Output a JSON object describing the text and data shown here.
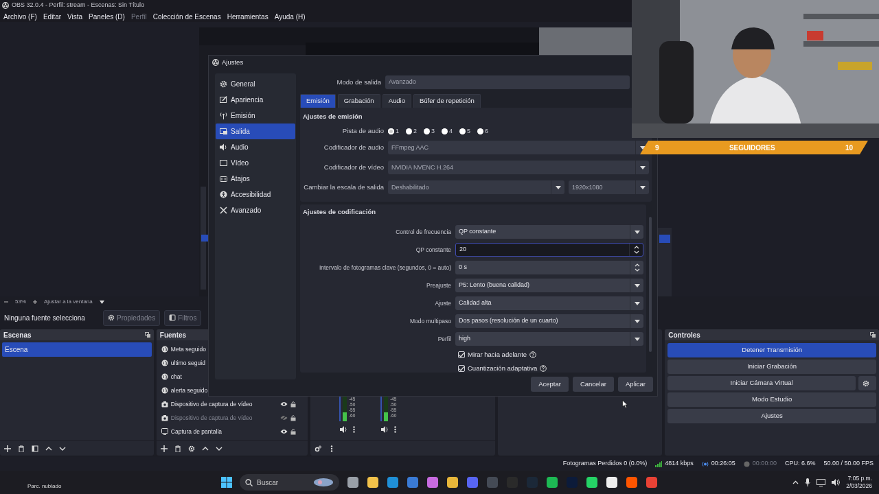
{
  "window": {
    "title": "OBS 32.0.4 - Perfil: stream - Escenas: Sin Título"
  },
  "menu": [
    {
      "label": "Archivo (F)",
      "disabled": false
    },
    {
      "label": "Editar",
      "disabled": false
    },
    {
      "label": "Vista",
      "disabled": false
    },
    {
      "label": "Paneles (D)",
      "disabled": false
    },
    {
      "label": "Perfil",
      "disabled": true
    },
    {
      "label": "Colección de Escenas",
      "disabled": false
    },
    {
      "label": "Herramientas",
      "disabled": false
    },
    {
      "label": "Ayuda (H)",
      "disabled": false
    }
  ],
  "zoom_bar": {
    "zoom": "53%",
    "fit": "Ajustar a la ventana"
  },
  "source_bar": {
    "status": "Ninguna fuente selecciona",
    "buttons": [
      {
        "label": "Propiedades",
        "disabled": true
      },
      {
        "label": "Filtros",
        "disabled": true
      }
    ]
  },
  "scenes": {
    "title": "Escenas",
    "items": [
      {
        "label": "Escena",
        "selected": true
      }
    ]
  },
  "sources": {
    "title": "Fuentes",
    "items": [
      {
        "label": "Meta seguido",
        "kind": "browser"
      },
      {
        "label": "ultimo seguid",
        "kind": "browser"
      },
      {
        "label": "chat",
        "kind": "browser"
      },
      {
        "label": "alerta seguido",
        "kind": "browser"
      },
      {
        "label": "Dispositivo de captura de vídeo",
        "kind": "camera",
        "visible": true
      },
      {
        "label": "Dispositivo de captura de vídeo",
        "kind": "camera",
        "visible": false
      },
      {
        "label": "Captura de pantalla",
        "kind": "screen",
        "visible": true
      }
    ]
  },
  "mixer": {
    "channels": [
      {
        "slider": {
          "level": 1
        },
        "meter": {
          "level": 0.35
        },
        "scale": [
          "-45",
          "-50",
          "-55",
          "-60"
        ]
      },
      {
        "slider": {
          "level": 1
        },
        "meter": {
          "level": 0.35
        },
        "scale": [
          "-45",
          "-50",
          "-55",
          "-60"
        ]
      }
    ]
  },
  "controls": {
    "title": "Controles",
    "buttons": [
      {
        "label": "Detener Transmisión",
        "active": true
      },
      {
        "label": "Iniciar Grabación",
        "active": false
      },
      {
        "label": "Iniciar Cámara Virtual",
        "active": false
      },
      {
        "label": "Modo Estudio",
        "active": false
      },
      {
        "label": "Ajustes",
        "active": false
      }
    ]
  },
  "goal_bar": {
    "current": "9",
    "label": "SEGUIDORES",
    "target": "10"
  },
  "settings": {
    "title": "Ajustes",
    "sidebar": [
      {
        "label": "General",
        "selected": false
      },
      {
        "label": "Apariencia",
        "selected": false
      },
      {
        "label": "Emisión",
        "selected": false
      },
      {
        "label": "Salida",
        "selected": true
      },
      {
        "label": "Audio",
        "selected": false
      },
      {
        "label": "Vídeo",
        "selected": false
      },
      {
        "label": "Atajos",
        "selected": false
      },
      {
        "label": "Accesibilidad",
        "selected": false
      },
      {
        "label": "Avanzado",
        "selected": false
      }
    ],
    "output_mode": {
      "label": "Modo de salida",
      "value": "Avanzado",
      "disabled": true
    },
    "tabs": [
      {
        "label": "Emisión",
        "selected": true
      },
      {
        "label": "Grabación",
        "selected": false
      },
      {
        "label": "Audio",
        "selected": false
      },
      {
        "label": "Búfer de repetición",
        "selected": false
      }
    ],
    "streaming": {
      "title": "Ajustes de emisión",
      "audio_track": {
        "label": "Pista de audio",
        "options": [
          {
            "label": "1",
            "selected": true
          },
          {
            "label": "2",
            "selected": false
          },
          {
            "label": "3",
            "selected": false
          },
          {
            "label": "4",
            "selected": false
          },
          {
            "label": "5",
            "selected": false
          },
          {
            "label": "6",
            "selected": false
          }
        ]
      },
      "fields": [
        {
          "label": "Codificador de audio",
          "value": "FFmpeg AAC",
          "disabled": true
        },
        {
          "label": "Codificador de vídeo",
          "value": "NVIDIA NVENC H.264",
          "disabled": true
        },
        {
          "label": "Cambiar la escala de salida",
          "value": "Deshabilitado",
          "value_2": "1920x1080",
          "disabled": true
        }
      ]
    },
    "encoder": {
      "title": "Ajustes de codificación",
      "fields": [
        {
          "label": "Control de frecuencia",
          "value": "QP constante",
          "kind": "select",
          "focused": false
        },
        {
          "label": "QP constante",
          "value": "20",
          "kind": "spin",
          "focused": true
        },
        {
          "label": "Intervalo de fotogramas clave (segundos, 0 = auto)",
          "value": "0 s",
          "kind": "spin",
          "focused": false
        },
        {
          "label": "Preajuste",
          "value": "P5: Lento (buena calidad)",
          "kind": "select",
          "focused": false
        },
        {
          "label": "Ajuste",
          "value": "Calidad alta",
          "kind": "select",
          "focused": false
        },
        {
          "label": "Modo multipaso",
          "value": "Dos pasos (resolución de un cuarto)",
          "kind": "select",
          "focused": false
        },
        {
          "label": "Perfil",
          "value": "high",
          "kind": "select",
          "focused": false
        }
      ],
      "checks": [
        {
          "label": "Mirar hacia adelante",
          "checked": true
        },
        {
          "label": "Cuantización adaptativa",
          "checked": true
        }
      ]
    },
    "buttons": [
      "Aceptar",
      "Cancelar",
      "Aplicar"
    ]
  },
  "status_bar": {
    "dropped": "Fotogramas Perdidos 0 (0.0%)",
    "bitrate": "4814 kbps",
    "stream_time": "00:26:05",
    "rec_time": "00:00:00",
    "cpu": "CPU: 6.6%",
    "fps": "50.00 / 50.00 FPS"
  },
  "taskbar": {
    "weather": "Parc. nublado",
    "search_placeholder": "Buscar",
    "apps": [
      {
        "color": "#9aa0a8"
      },
      {
        "color": "#f2c24a"
      },
      {
        "color": "#1f8fd6"
      },
      {
        "color": "#3a7bd5"
      },
      {
        "color": "#c86be0"
      },
      {
        "color": "#e8b73a"
      },
      {
        "color": "#5865f2"
      },
      {
        "color": "#444a55"
      },
      {
        "color": "#2a2a2a"
      },
      {
        "color": "#1b2838"
      },
      {
        "color": "#1db954"
      },
      {
        "color": "#0c1b3a"
      },
      {
        "color": "#25d366"
      },
      {
        "color": "#eeeeee"
      },
      {
        "color": "#ff5500"
      },
      {
        "color": "#e94235"
      }
    ],
    "time": "7:05 p.m.",
    "date": "2/03/2026"
  }
}
